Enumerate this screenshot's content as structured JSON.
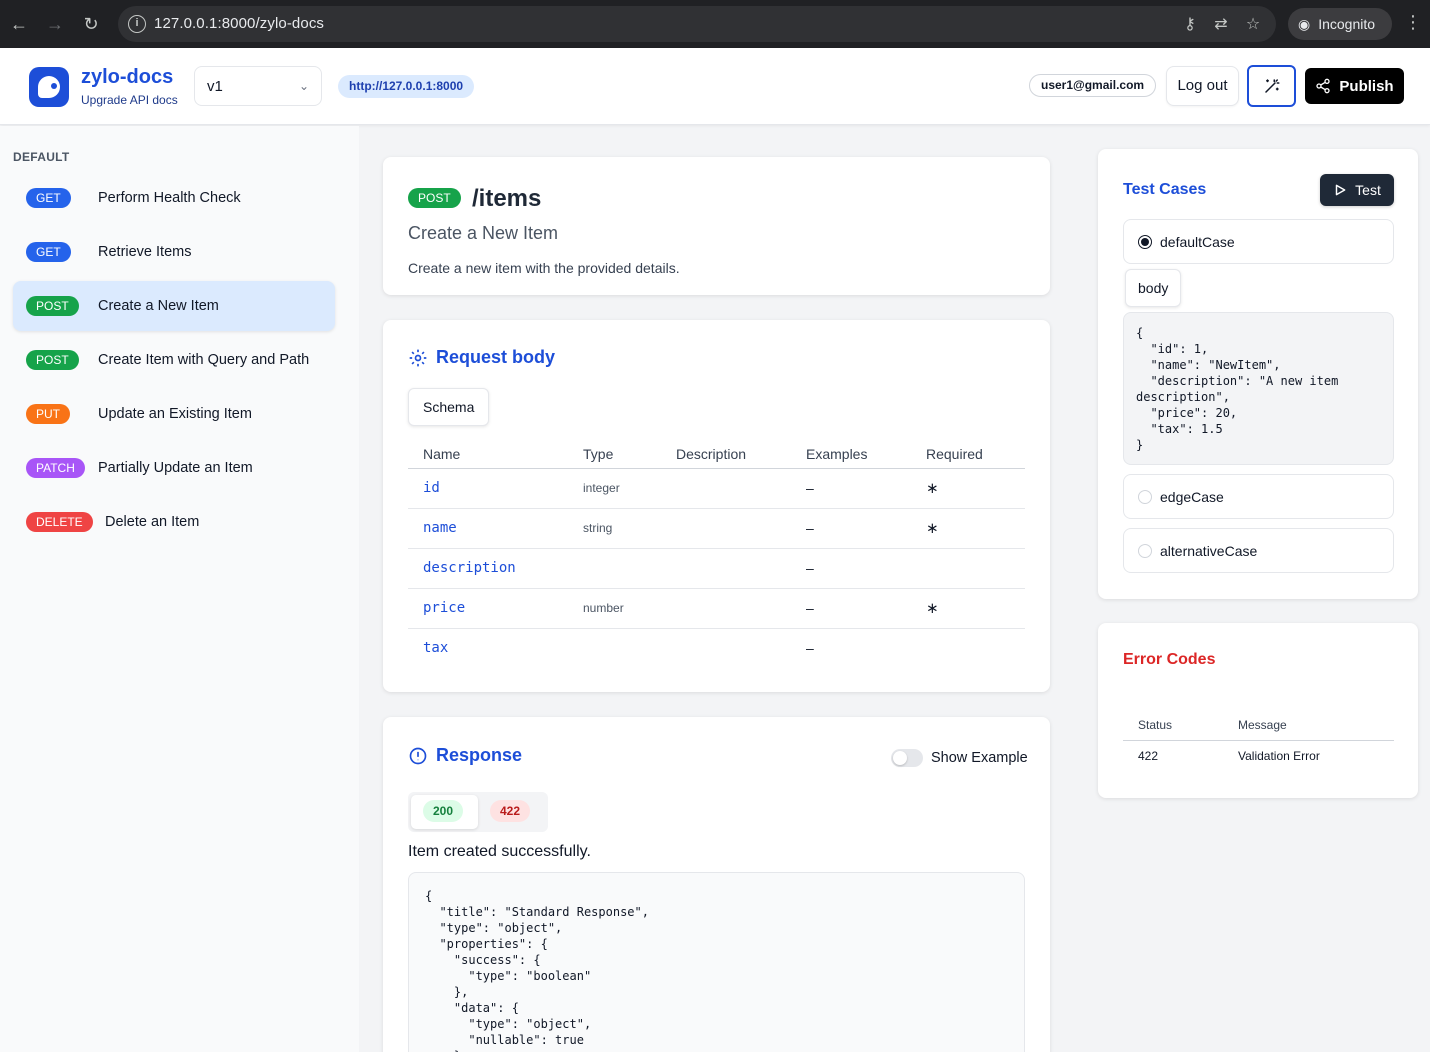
{
  "browser": {
    "url": "127.0.0.1:8000/zylo-docs",
    "profile_label": "Incognito"
  },
  "header": {
    "brand": "zylo-docs",
    "tagline": "Upgrade API docs",
    "version": "v1",
    "server_url": "http://127.0.0.1:8000",
    "user_email": "user1@gmail.com",
    "logout_label": "Log out",
    "publish_label": "Publish"
  },
  "sidebar": {
    "section_label": "DEFAULT",
    "items": [
      {
        "method": "GET",
        "label": "Perform Health Check",
        "color": "#2563eb"
      },
      {
        "method": "GET",
        "label": "Retrieve Items",
        "color": "#2563eb"
      },
      {
        "method": "POST",
        "label": "Create a New Item",
        "color": "#16a34a",
        "active": true
      },
      {
        "method": "POST",
        "label": "Create Item with Query and Path",
        "color": "#16a34a"
      },
      {
        "method": "PUT",
        "label": "Update an Existing Item",
        "color": "#f97316"
      },
      {
        "method": "PATCH",
        "label": "Partially Update an Item",
        "color": "#a855f7"
      },
      {
        "method": "DELETE",
        "label": "Delete an Item",
        "color": "#ef4444"
      }
    ]
  },
  "endpoint": {
    "method": "POST",
    "path": "/items",
    "summary": "Create a New Item",
    "description": "Create a new item with the provided details."
  },
  "request_body": {
    "title": "Request body",
    "tab_label": "Schema",
    "columns": [
      "Name",
      "Type",
      "Description",
      "Examples",
      "Required"
    ],
    "rows": [
      {
        "name": "id",
        "type": "integer",
        "description": "",
        "examples": "–",
        "required": "∗"
      },
      {
        "name": "name",
        "type": "string",
        "description": "",
        "examples": "–",
        "required": "∗"
      },
      {
        "name": "description",
        "type": "",
        "description": "",
        "examples": "–",
        "required": ""
      },
      {
        "name": "price",
        "type": "number",
        "description": "",
        "examples": "–",
        "required": "∗"
      },
      {
        "name": "tax",
        "type": "",
        "description": "",
        "examples": "–",
        "required": ""
      }
    ]
  },
  "response": {
    "title": "Response",
    "toggle_label": "Show Example",
    "status_codes": [
      "200",
      "422"
    ],
    "description": "Item created successfully.",
    "schema_code": "{\n  \"title\": \"Standard Response\",\n  \"type\": \"object\",\n  \"properties\": {\n    \"success\": {\n      \"type\": \"boolean\"\n    },\n    \"data\": {\n      \"type\": \"object\",\n      \"nullable\": true\n    },"
  },
  "test_cases": {
    "title": "Test Cases",
    "test_button": "Test",
    "cases": [
      "defaultCase",
      "edgeCase",
      "alternativeCase"
    ],
    "body_tab": "body",
    "body_code": "{\n  \"id\": 1,\n  \"name\": \"NewItem\",\n  \"description\": \"A new item description\",\n  \"price\": 20,\n  \"tax\": 1.5\n}"
  },
  "error_codes": {
    "title": "Error Codes",
    "columns": [
      "Status",
      "Message"
    ],
    "rows": [
      {
        "status": "422",
        "message": "Validation Error"
      }
    ]
  },
  "colors": {
    "accent": "#1d4ed8",
    "error_title": "#dc2626"
  }
}
